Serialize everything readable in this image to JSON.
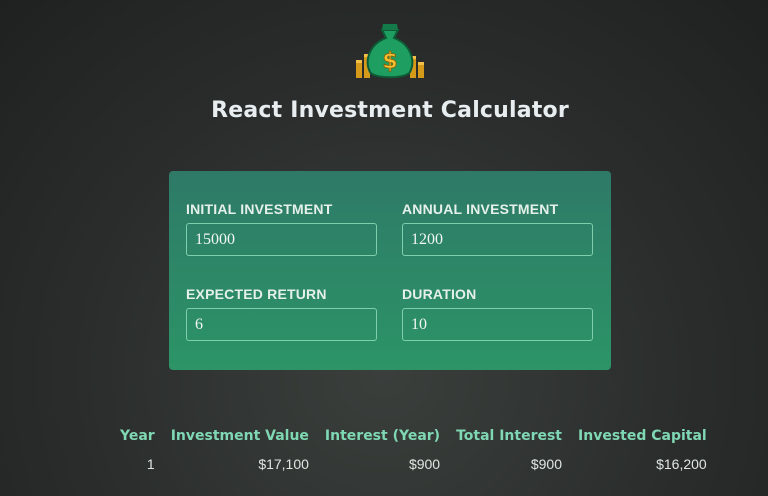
{
  "header": {
    "logo_icon": "money-bag-icon",
    "title": "React Investment Calculator"
  },
  "inputs": {
    "initial_investment": {
      "label": "INITIAL INVESTMENT",
      "value": "15000"
    },
    "annual_investment": {
      "label": "ANNUAL INVESTMENT",
      "value": "1200"
    },
    "expected_return": {
      "label": "EXPECTED RETURN",
      "value": "6"
    },
    "duration": {
      "label": "DURATION",
      "value": "10"
    }
  },
  "results": {
    "columns": [
      "Year",
      "Investment Value",
      "Interest (Year)",
      "Total Interest",
      "Invested Capital"
    ],
    "rows": [
      [
        "1",
        "$17,100",
        "$900",
        "$900",
        "$16,200"
      ]
    ]
  },
  "colors": {
    "card_top": "#2e7a67",
    "card_bottom": "#2c9467",
    "header_text": "#7fd7b3",
    "background": "#2a2d2c"
  }
}
